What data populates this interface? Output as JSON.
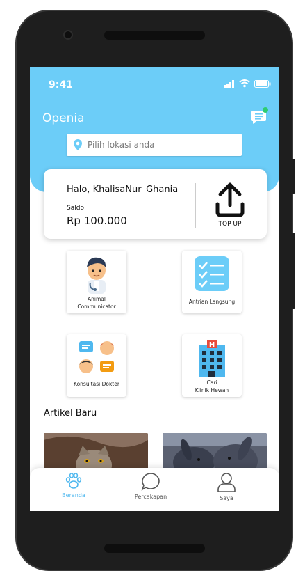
{
  "status_bar": {
    "time": "9:41"
  },
  "header": {
    "title": "Openia"
  },
  "search": {
    "placeholder": "Pilih lokasi anda"
  },
  "balance_card": {
    "greeting": "Halo, KhalisaNur_Ghania",
    "saldo_label": "Saldo",
    "saldo_value": "Rp 100.000",
    "topup_label": "TOP UP"
  },
  "menu": {
    "animal_communicator": "Animal\nCommunicator",
    "antrian_langsung": "Antrian Langsung",
    "konsultasi_dokter": "Konsultasi Dokter",
    "cari_klinik": "Cari\nKlinik Hewan"
  },
  "articles": {
    "section_title": "Artikel Baru"
  },
  "bottom_nav": {
    "items": [
      {
        "label": "Beranda",
        "active": true
      },
      {
        "label": "Percakapan",
        "active": false
      },
      {
        "label": "Saya",
        "active": false
      }
    ]
  },
  "colors": {
    "accent": "#6ccdf8",
    "notification": "#2ecc71",
    "nav_active": "#4fb8ef",
    "nav_inactive": "#555555"
  }
}
